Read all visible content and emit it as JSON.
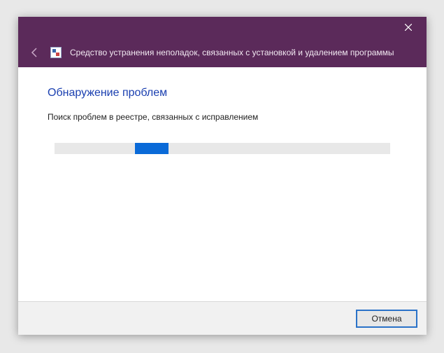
{
  "window": {
    "title": "Средство устранения неполадок, связанных с установкой и удалением программы"
  },
  "content": {
    "heading": "Обнаружение проблем",
    "status": "Поиск проблем в реестре, связанных с исправлением"
  },
  "footer": {
    "cancel_label": "Отмена"
  }
}
